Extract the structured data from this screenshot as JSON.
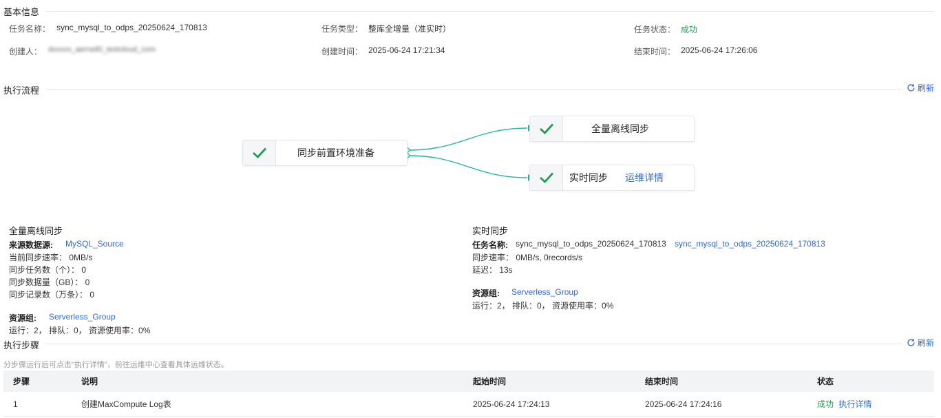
{
  "basic": {
    "title": "基本信息",
    "task_name_label": "任务名称：",
    "task_name": "sync_mysql_to_odps_20250624_170813",
    "task_type_label": "任务类型：",
    "task_type": "整库全增量（准实时）",
    "task_status_label": "任务状态：",
    "task_status": "成功",
    "creator_label": "创建人：",
    "creator": "dxxxxx_aerneil0_testcloud_com",
    "created_label": "创建时间：",
    "created": "2025-06-24 17:21:34",
    "ended_label": "结束时间：",
    "ended": "2025-06-24 17:26:06"
  },
  "flow": {
    "title": "执行流程",
    "refresh": "刷新",
    "node_prepare": "同步前置环境准备",
    "node_full": "全量离线同步",
    "node_realtime": "实时同步",
    "node_realtime_link": "运维详情",
    "accent": "#1ab7a3",
    "check_color": "#1e9e4f"
  },
  "full_sync": {
    "title": "全量离线同步",
    "source_label": "来源数据源:",
    "source": "MySQL_Source",
    "rate": "当前同步速率：   0MB/s",
    "tasks": "同步任务数（个）：  0",
    "volume": "同步数据量（GB）：  0",
    "records": "同步记录数（万条）：  0",
    "rg_label": "资源组:",
    "rg": "Serverless_Group",
    "rg_stats": "运行：2，  排队：0，  资源使用率：0%"
  },
  "rt_sync": {
    "title": "实时同步",
    "task_label": "任务名称:",
    "task_name": "sync_mysql_to_odps_20250624_170813",
    "task_link": "sync_mysql_to_odps_20250624_170813",
    "rate": "同步速率：   0MB/s, 0records/s",
    "delay": "延迟：   13s",
    "rg_label": "资源组:",
    "rg": "Serverless_Group",
    "rg_stats": "运行：2，  排队：0，  资源使用率：0%"
  },
  "steps": {
    "title": "执行步骤",
    "refresh": "刷新",
    "hint": "分步骤运行后可点击\"执行详情\"，前往运维中心查看具体运维状态。",
    "columns": [
      "步骤",
      "说明",
      "起始时间",
      "结束时间",
      "状态"
    ],
    "rows": [
      {
        "step": "1",
        "desc": "创建MaxCompute Log表",
        "start": "2025-06-24 17:24:13",
        "end": "2025-06-24 17:24:16",
        "status": "成功",
        "action": "执行详情"
      }
    ]
  }
}
